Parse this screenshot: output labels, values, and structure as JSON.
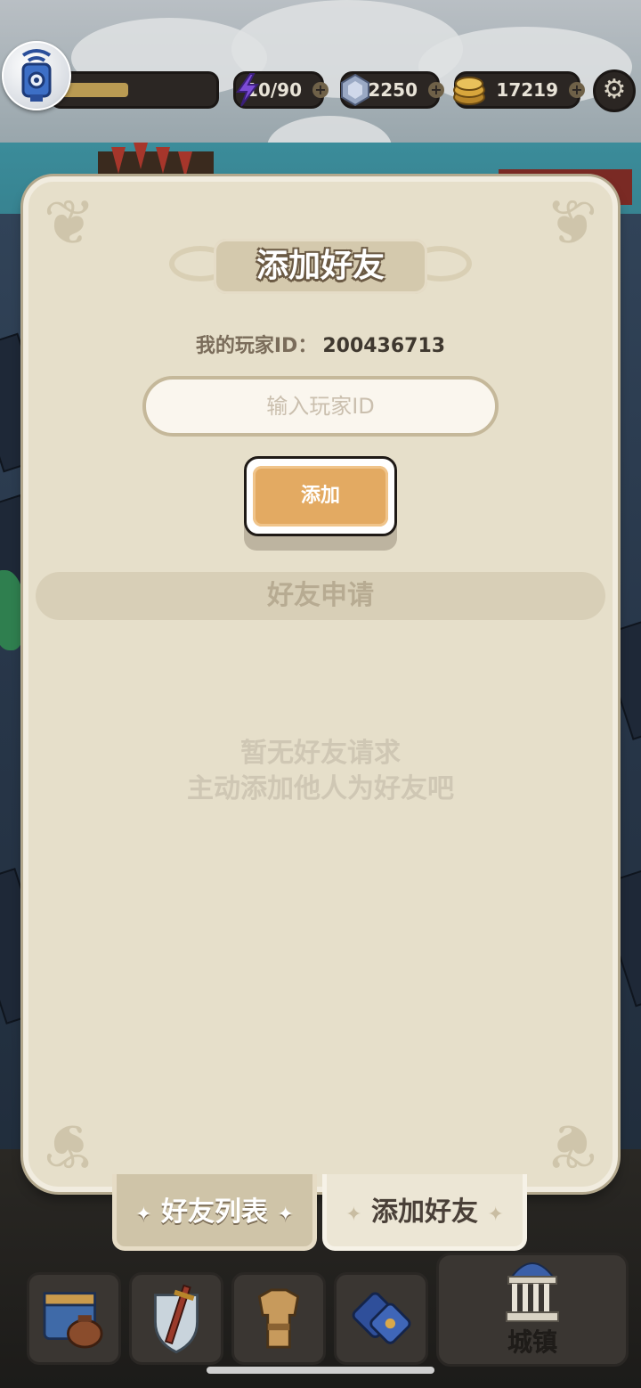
{
  "hud": {
    "xp_fill": 0.45,
    "energy": "10/90",
    "gems": "2250",
    "gold": "17219",
    "plus": "+"
  },
  "dialog": {
    "title": "添加好友",
    "my_id_label": "我的玩家ID：",
    "my_id_value": "200436713",
    "input_placeholder": "输入玩家ID",
    "add_button": "添加",
    "section_title": "好友申请",
    "empty_line1": "暂无好友请求",
    "empty_line2": "主动添加他人为好友吧"
  },
  "tabs": {
    "friend_list": "好友列表",
    "add_friend": "添加好友",
    "deco_left": "✦",
    "deco_right": "✦"
  },
  "nav": {
    "town_label": "城镇"
  },
  "colors": {
    "panel": "#e6dfca",
    "button": "#e3aa62",
    "text_dark": "#3f382f"
  }
}
